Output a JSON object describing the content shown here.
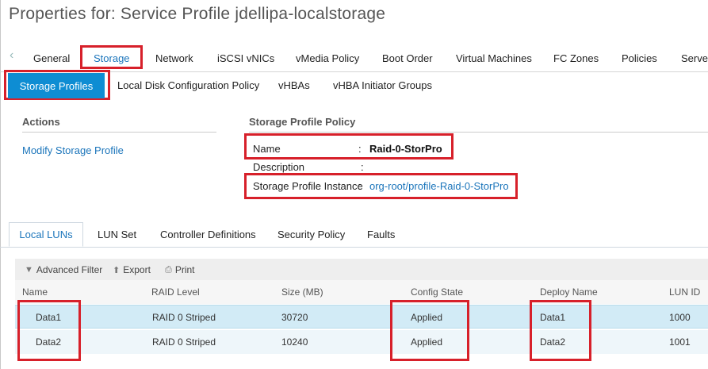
{
  "title": "Properties for: Service Profile jdellipa-localstorage",
  "main_tabs": [
    "General",
    "Storage",
    "Network",
    "iSCSI vNICs",
    "vMedia Policy",
    "Boot Order",
    "Virtual Machines",
    "FC Zones",
    "Policies",
    "Server"
  ],
  "sub_tabs": [
    "Storage Profiles",
    "Local Disk Configuration Policy",
    "vHBAs",
    "vHBA Initiator Groups"
  ],
  "actions": {
    "heading": "Actions",
    "modify": "Modify Storage Profile"
  },
  "policy": {
    "heading": "Storage Profile Policy",
    "name_label": "Name",
    "name_value": "Raid-0-StorPro",
    "description_label": "Description",
    "instance_label": "Storage Profile Instance",
    "instance_value": "org-root/profile-Raid-0-StorPro",
    "sep": ":"
  },
  "lun_tabs": [
    "Local LUNs",
    "LUN Set",
    "Controller Definitions",
    "Security Policy",
    "Faults"
  ],
  "toolbar": {
    "filter": "Advanced Filter",
    "export": "Export",
    "print": "Print"
  },
  "table": {
    "columns": [
      "Name",
      "RAID Level",
      "Size (MB)",
      "Config State",
      "Deploy Name",
      "LUN ID"
    ],
    "rows": [
      [
        "Data1",
        "RAID 0 Striped",
        "30720",
        "Applied",
        "Data1",
        "1000"
      ],
      [
        "Data2",
        "RAID 0 Striped",
        "10240",
        "Applied",
        "Data2",
        "1001"
      ]
    ]
  },
  "colors": {
    "accent": "#0e8dd3",
    "highlight": "#d7202a",
    "link": "#1b75bb"
  }
}
